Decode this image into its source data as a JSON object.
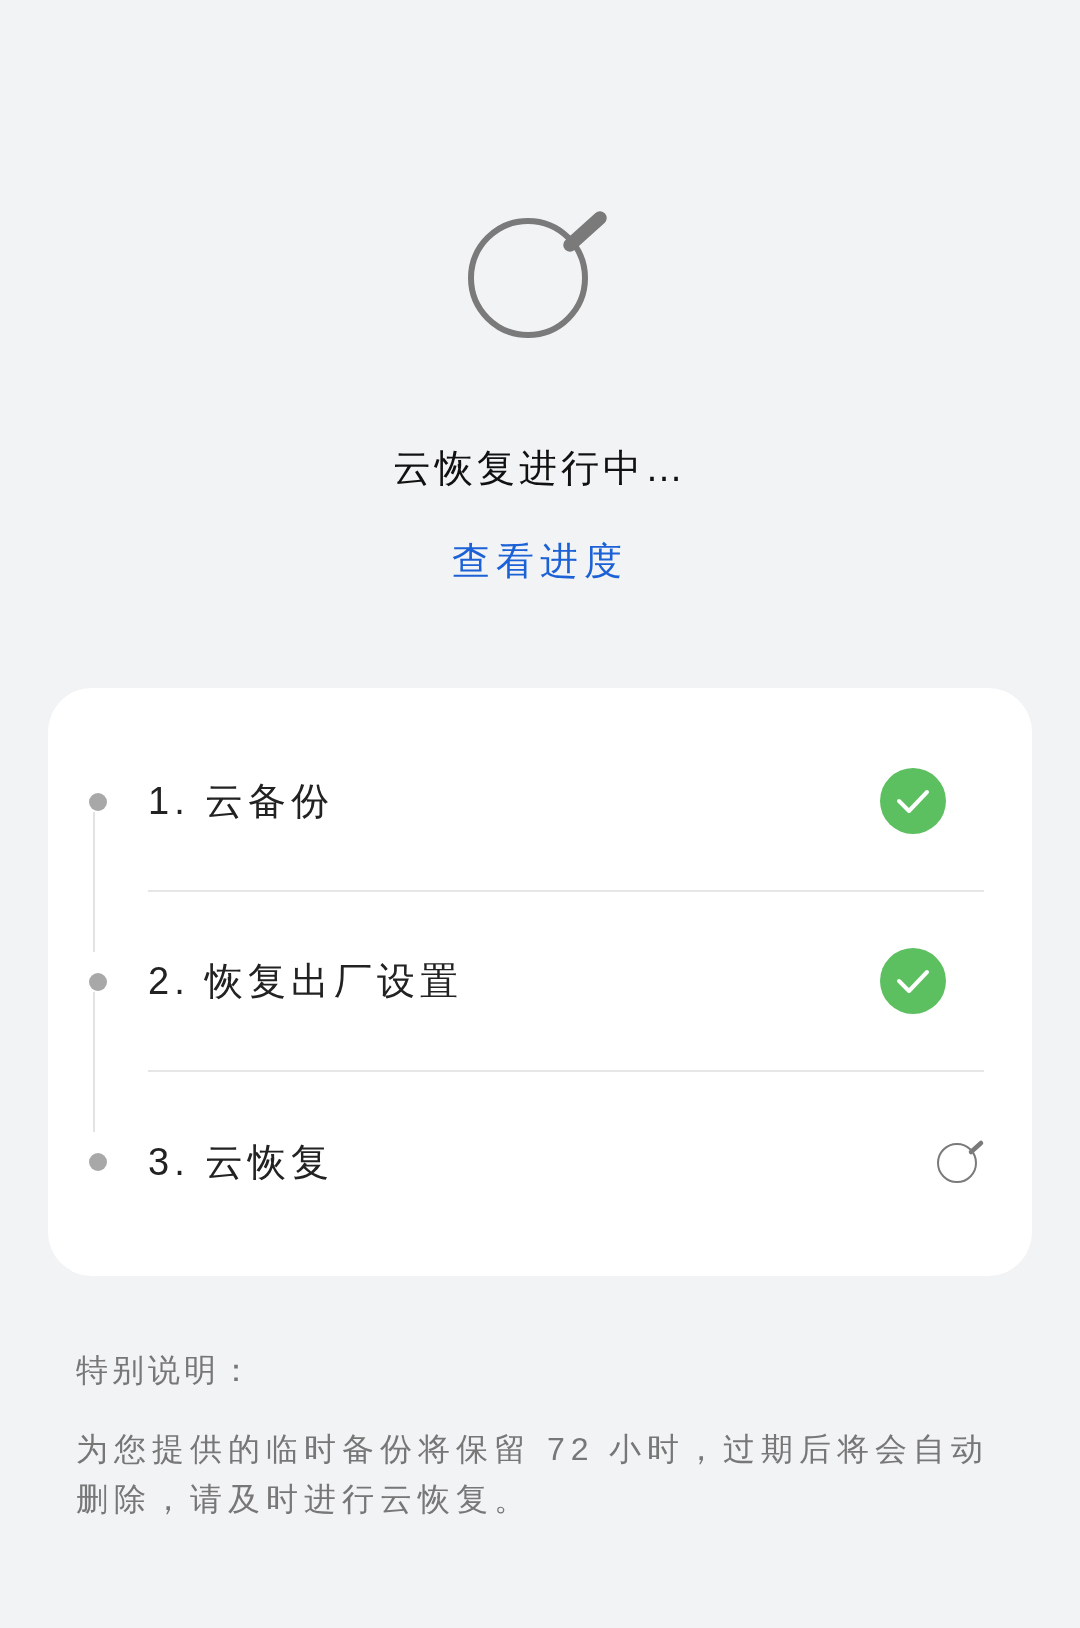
{
  "status": {
    "title": "云恢复进行中…",
    "link": "查看进度"
  },
  "steps": [
    {
      "label": "1. 云备份",
      "kind": "done"
    },
    {
      "label": "2. 恢复出厂设置",
      "kind": "done"
    },
    {
      "label": "3. 云恢复",
      "kind": "in_progress"
    }
  ],
  "note": {
    "heading": "特别说明：",
    "body": "为您提供的临时备份将保留 72 小时，过期后将会自动删除，请及时进行云恢复。"
  }
}
